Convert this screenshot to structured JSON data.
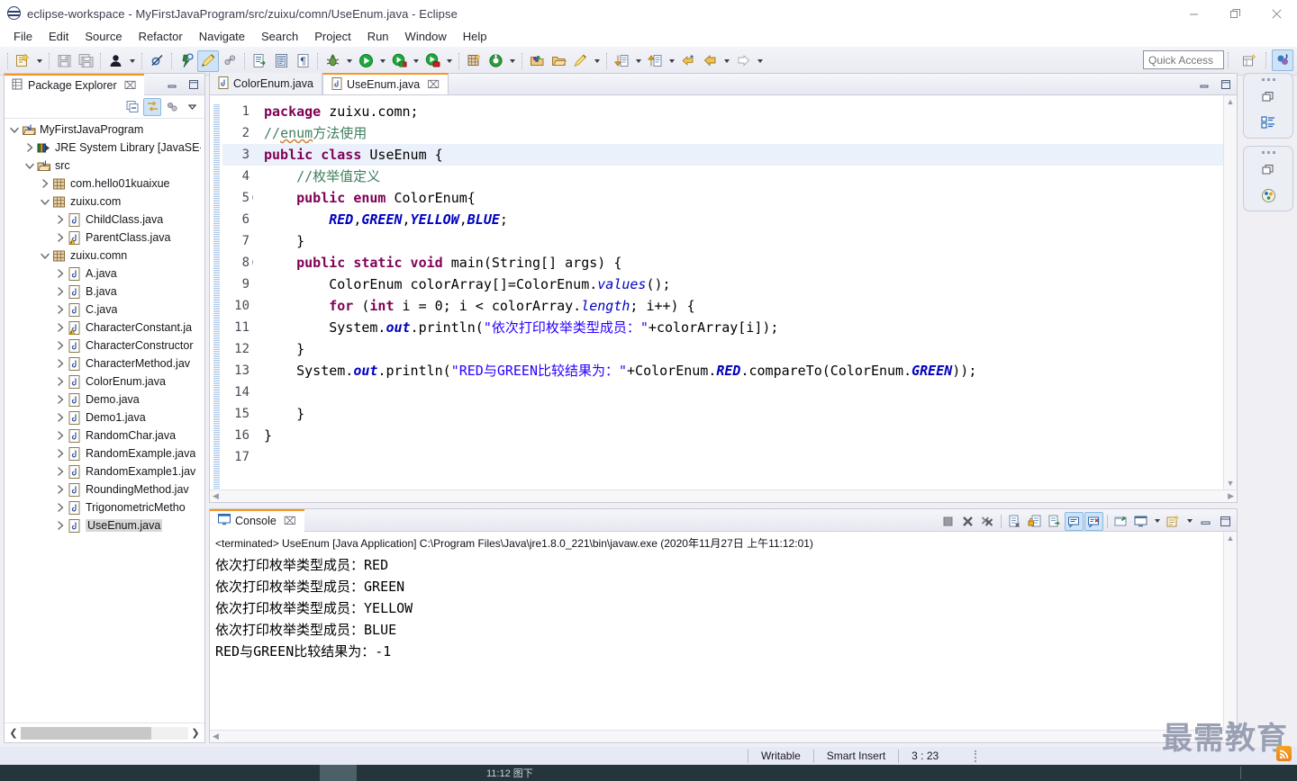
{
  "window": {
    "title": "eclipse-workspace - MyFirstJavaProgram/src/zuixu/comn/UseEnum.java - Eclipse",
    "app_icon": "eclipse-icon",
    "minimize_label": "—",
    "restore_label": "❐",
    "close_label": "✕"
  },
  "menubar": {
    "items": [
      {
        "label": "File"
      },
      {
        "label": "Edit"
      },
      {
        "label": "Source"
      },
      {
        "label": "Refactor"
      },
      {
        "label": "Navigate"
      },
      {
        "label": "Search"
      },
      {
        "label": "Project"
      },
      {
        "label": "Run"
      },
      {
        "label": "Window"
      },
      {
        "label": "Help"
      }
    ]
  },
  "toolbar": {
    "quick_access_placeholder": "Quick Access",
    "buttons": [
      {
        "name": "new-wizard-icon",
        "title": "New"
      },
      {
        "name": "save-icon",
        "title": "Save"
      },
      {
        "name": "save-all-icon",
        "title": "Save All"
      },
      {
        "name": "person-icon",
        "title": "Toggle Breadcrumb"
      },
      {
        "name": "skip-breakpoints-icon",
        "title": "Skip All Breakpoints"
      },
      {
        "name": "build-icon",
        "title": "Build"
      },
      {
        "name": "pencil-icon",
        "title": "Edit"
      },
      {
        "name": "link-icon",
        "title": "Link"
      },
      {
        "name": "open-type-icon",
        "title": "Open Type"
      },
      {
        "name": "open-task-icon",
        "title": "Open Task"
      },
      {
        "name": "pilcrow-icon",
        "title": "Formatting"
      },
      {
        "name": "debug-bug-icon",
        "title": "Debug"
      },
      {
        "name": "run-icon",
        "title": "Run"
      },
      {
        "name": "external-tools-icon",
        "title": "External Tools"
      },
      {
        "name": "coverage-icon",
        "title": "Coverage"
      },
      {
        "name": "new-java-project-icon",
        "title": "New Java Project"
      },
      {
        "name": "new-class-icon",
        "title": "New Java Class"
      },
      {
        "name": "open-package-icon",
        "title": "Open Package"
      },
      {
        "name": "open-folder-icon",
        "title": "Open Folder"
      },
      {
        "name": "search-pen-icon",
        "title": "Search"
      },
      {
        "name": "next-annotation-icon",
        "title": "Next Annotation"
      },
      {
        "name": "previous-annotation-icon",
        "title": "Previous Annotation"
      },
      {
        "name": "back-edit-icon",
        "title": "Last Edit Location"
      },
      {
        "name": "back-icon",
        "title": "Back"
      },
      {
        "name": "forward-icon",
        "title": "Forward"
      }
    ],
    "perspective_buttons": [
      {
        "name": "open-perspective-icon",
        "title": "Open Perspective"
      },
      {
        "name": "java-perspective-icon",
        "title": "Java"
      }
    ]
  },
  "explorer": {
    "tab_title": "Package Explorer",
    "tab_close": "⌧",
    "toolbar_buttons": [
      {
        "name": "collapse-all-icon",
        "title": "Collapse All"
      },
      {
        "name": "link-with-editor-icon",
        "title": "Link with Editor",
        "selected": true
      },
      {
        "name": "focus-on-active-task-icon",
        "title": "Focus on Active Task"
      },
      {
        "name": "view-menu-icon",
        "title": "View Menu"
      }
    ],
    "tree": [
      {
        "label": "MyFirstJavaProgram",
        "indent": 0,
        "twisty": "down",
        "icon": "java-project-icon",
        "selected": false
      },
      {
        "label": "JRE System Library [JavaSE-",
        "indent": 1,
        "twisty": "right",
        "icon": "library-icon",
        "selected": false
      },
      {
        "label": "src",
        "indent": 1,
        "twisty": "down",
        "icon": "source-folder-icon",
        "selected": false
      },
      {
        "label": "com.hello01kuaixue",
        "indent": 2,
        "twisty": "right",
        "icon": "package-icon",
        "selected": false
      },
      {
        "label": "zuixu.com",
        "indent": 2,
        "twisty": "down",
        "icon": "package-icon",
        "selected": false
      },
      {
        "label": "ChildClass.java",
        "indent": 3,
        "twisty": "right",
        "icon": "java-file-icon",
        "selected": false
      },
      {
        "label": "ParentClass.java",
        "indent": 3,
        "twisty": "right",
        "icon": "java-file-warn-icon",
        "selected": false
      },
      {
        "label": "zuixu.comn",
        "indent": 2,
        "twisty": "down",
        "icon": "package-icon",
        "selected": false
      },
      {
        "label": "A.java",
        "indent": 3,
        "twisty": "right",
        "icon": "java-file-icon",
        "selected": false
      },
      {
        "label": "B.java",
        "indent": 3,
        "twisty": "right",
        "icon": "java-file-icon",
        "selected": false
      },
      {
        "label": "C.java",
        "indent": 3,
        "twisty": "right",
        "icon": "java-file-icon",
        "selected": false
      },
      {
        "label": "CharacterConstant.ja",
        "indent": 3,
        "twisty": "right",
        "icon": "java-file-warn-icon",
        "selected": false
      },
      {
        "label": "CharacterConstructor",
        "indent": 3,
        "twisty": "right",
        "icon": "java-file-icon",
        "selected": false
      },
      {
        "label": "CharacterMethod.jav",
        "indent": 3,
        "twisty": "right",
        "icon": "java-file-icon",
        "selected": false
      },
      {
        "label": "ColorEnum.java",
        "indent": 3,
        "twisty": "right",
        "icon": "java-file-icon",
        "selected": false
      },
      {
        "label": "Demo.java",
        "indent": 3,
        "twisty": "right",
        "icon": "java-file-icon",
        "selected": false
      },
      {
        "label": "Demo1.java",
        "indent": 3,
        "twisty": "right",
        "icon": "java-file-icon",
        "selected": false
      },
      {
        "label": "RandomChar.java",
        "indent": 3,
        "twisty": "right",
        "icon": "java-file-icon",
        "selected": false
      },
      {
        "label": "RandomExample.java",
        "indent": 3,
        "twisty": "right",
        "icon": "java-file-icon",
        "selected": false
      },
      {
        "label": "RandomExample1.jav",
        "indent": 3,
        "twisty": "right",
        "icon": "java-file-icon",
        "selected": false
      },
      {
        "label": "RoundingMethod.jav",
        "indent": 3,
        "twisty": "right",
        "icon": "java-file-icon",
        "selected": false
      },
      {
        "label": "TrigonometricMetho",
        "indent": 3,
        "twisty": "right",
        "icon": "java-file-icon",
        "selected": false
      },
      {
        "label": "UseEnum.java",
        "indent": 3,
        "twisty": "right",
        "icon": "java-file-icon",
        "selected": true
      }
    ]
  },
  "editor": {
    "tabs": [
      {
        "label": "ColorEnum.java",
        "active": false,
        "closable": false
      },
      {
        "label": "UseEnum.java",
        "active": true,
        "closable": true,
        "close": "⌧"
      }
    ],
    "highlight_line": 3,
    "fold_lines": [
      5,
      8
    ],
    "lines": [
      {
        "n": 1,
        "tokens": [
          {
            "t": "package",
            "c": "kw"
          },
          {
            "t": " zuixu.comn;",
            "c": "plain"
          }
        ]
      },
      {
        "n": 2,
        "tokens": [
          {
            "t": "//",
            "c": "cm"
          },
          {
            "t": "enum",
            "c": "cm wavy"
          },
          {
            "t": "方法使用",
            "c": "cm"
          }
        ]
      },
      {
        "n": 3,
        "tokens": [
          {
            "t": "public class ",
            "c": "kw"
          },
          {
            "t": "UseEnum {",
            "c": "plain"
          }
        ]
      },
      {
        "n": 4,
        "tokens": [
          {
            "t": "    //枚举值定义",
            "c": "cm"
          }
        ]
      },
      {
        "n": 5,
        "tokens": [
          {
            "t": "    public enum ",
            "c": "kw"
          },
          {
            "t": "ColorEnum{",
            "c": "plain"
          }
        ]
      },
      {
        "n": 6,
        "tokens": [
          {
            "t": "        ",
            "c": "plain"
          },
          {
            "t": "RED",
            "c": "sf"
          },
          {
            "t": ",",
            "c": "plain"
          },
          {
            "t": "GREEN",
            "c": "sf"
          },
          {
            "t": ",",
            "c": "plain"
          },
          {
            "t": "YELLOW",
            "c": "sf"
          },
          {
            "t": ",",
            "c": "plain"
          },
          {
            "t": "BLUE",
            "c": "sf"
          },
          {
            "t": ";",
            "c": "plain"
          }
        ]
      },
      {
        "n": 7,
        "tokens": [
          {
            "t": "    }",
            "c": "plain"
          }
        ]
      },
      {
        "n": 8,
        "tokens": [
          {
            "t": "    public static void ",
            "c": "kw"
          },
          {
            "t": "main(String[] args) {",
            "c": "plain"
          }
        ]
      },
      {
        "n": 9,
        "tokens": [
          {
            "t": "        ColorEnum colorArray[]=ColorEnum.",
            "c": "plain"
          },
          {
            "t": "values",
            "c": "fld"
          },
          {
            "t": "();",
            "c": "plain"
          }
        ]
      },
      {
        "n": 10,
        "tokens": [
          {
            "t": "        ",
            "c": "plain"
          },
          {
            "t": "for",
            "c": "kw"
          },
          {
            "t": " (",
            "c": "plain"
          },
          {
            "t": "int",
            "c": "kw"
          },
          {
            "t": " i = ",
            "c": "plain"
          },
          {
            "t": "0",
            "c": "plain"
          },
          {
            "t": "; i < colorArray.",
            "c": "plain"
          },
          {
            "t": "length",
            "c": "fld"
          },
          {
            "t": "; i++) {",
            "c": "plain"
          }
        ]
      },
      {
        "n": 11,
        "tokens": [
          {
            "t": "        System.",
            "c": "plain"
          },
          {
            "t": "out",
            "c": "sf"
          },
          {
            "t": ".println(",
            "c": "plain"
          },
          {
            "t": "\"依次打印枚举类型成员：\"",
            "c": "str"
          },
          {
            "t": "+colorArray[i]);",
            "c": "plain"
          }
        ]
      },
      {
        "n": 12,
        "tokens": [
          {
            "t": "    }",
            "c": "plain"
          }
        ]
      },
      {
        "n": 13,
        "tokens": [
          {
            "t": "    System.",
            "c": "plain"
          },
          {
            "t": "out",
            "c": "sf"
          },
          {
            "t": ".println(",
            "c": "plain"
          },
          {
            "t": "\"RED与GREEN比较结果为：\"",
            "c": "str"
          },
          {
            "t": "+ColorEnum.",
            "c": "plain"
          },
          {
            "t": "RED",
            "c": "sf"
          },
          {
            "t": ".compareTo(ColorEnum.",
            "c": "plain"
          },
          {
            "t": "GREEN",
            "c": "sf"
          },
          {
            "t": "));",
            "c": "plain"
          }
        ]
      },
      {
        "n": 14,
        "tokens": [
          {
            "t": "",
            "c": "plain"
          }
        ]
      },
      {
        "n": 15,
        "tokens": [
          {
            "t": "    }",
            "c": "plain"
          }
        ]
      },
      {
        "n": 16,
        "tokens": [
          {
            "t": "}",
            "c": "plain"
          }
        ]
      },
      {
        "n": 17,
        "tokens": [
          {
            "t": "",
            "c": "plain"
          }
        ]
      }
    ]
  },
  "console": {
    "tab_title": "Console",
    "tab_close": "⌧",
    "header": "<terminated> UseEnum [Java Application] C:\\Program Files\\Java\\jre1.8.0_221\\bin\\javaw.exe (2020年11月27日 上午11:12:01)",
    "output": [
      "依次打印枚举类型成员：RED",
      "依次打印枚举类型成员：GREEN",
      "依次打印枚举类型成员：YELLOW",
      "依次打印枚举类型成员：BLUE",
      "RED与GREEN比较结果为：-1"
    ],
    "toolbar_buttons": [
      {
        "name": "terminate-icon",
        "title": "Terminate"
      },
      {
        "name": "remove-launch-icon",
        "title": "Remove Launch"
      },
      {
        "name": "remove-all-terminated-icon",
        "title": "Remove All Terminated Launches"
      },
      {
        "name": "clear-console-icon",
        "title": "Clear Console"
      },
      {
        "name": "scroll-lock-icon",
        "title": "Scroll Lock"
      },
      {
        "name": "word-wrap-icon",
        "title": "Word Wrap"
      },
      {
        "name": "show-console-on-output-icon",
        "title": "Show Console When Standard Out Changes",
        "selected": true
      },
      {
        "name": "show-console-on-error-icon",
        "title": "Show Console When Standard Error Changes",
        "selected": true
      },
      {
        "name": "pin-console-icon",
        "title": "Pin Console"
      },
      {
        "name": "display-console-icon",
        "title": "Display Selected Console"
      },
      {
        "name": "new-console-view-icon",
        "title": "Open Console"
      },
      {
        "name": "minimize-icon",
        "title": "Minimize"
      },
      {
        "name": "maximize-icon",
        "title": "Maximize"
      }
    ]
  },
  "fastbar": {
    "groups": [
      {
        "buttons": [
          {
            "name": "restore-icon",
            "title": "Restore"
          },
          {
            "name": "outline-view-icon",
            "title": "Outline"
          }
        ]
      },
      {
        "buttons": [
          {
            "name": "restore-icon",
            "title": "Restore"
          },
          {
            "name": "palette-icon",
            "title": "Color Palette"
          }
        ]
      }
    ]
  },
  "statusbar": {
    "writable": "Writable",
    "insert_mode": "Smart Insert",
    "cursor_position": "3 : 23"
  },
  "watermark": {
    "text": "最需教育",
    "badge_icon": "rss-icon"
  },
  "taskbar": {
    "label": "11:12 图下"
  },
  "colors": {
    "accent_tab": "#f79522",
    "keyword": "#7f0055",
    "string": "#2a00ff",
    "comment": "#3f7f5f",
    "static_field": "#0000c0",
    "selection": "#eaf1fb",
    "chrome": "#e7e9f4"
  }
}
